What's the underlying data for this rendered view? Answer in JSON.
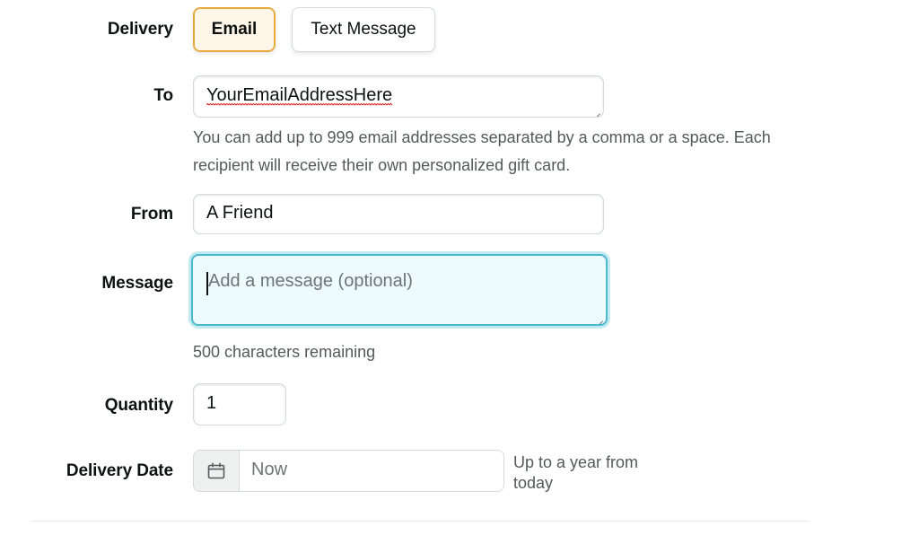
{
  "form": {
    "delivery": {
      "label": "Delivery",
      "options": [
        {
          "label": "Email",
          "selected": true
        },
        {
          "label": "Text Message",
          "selected": false
        }
      ]
    },
    "to": {
      "label": "To",
      "value": "YourEmailAddressHere",
      "helper": "You can add up to 999 email addresses separated by a comma or a space. Each recipient will receive their own personalized gift card."
    },
    "from": {
      "label": "From",
      "value": "A Friend"
    },
    "message": {
      "label": "Message",
      "value": "",
      "placeholder": "Add a message (optional)",
      "helper": "500 characters remaining",
      "focused": true
    },
    "quantity": {
      "label": "Quantity",
      "value": "1"
    },
    "delivery_date": {
      "label": "Delivery Date",
      "placeholder": "Now",
      "icon": "calendar-icon",
      "note": "Up to a year from today"
    }
  },
  "colors": {
    "selected_border": "#e6a93b",
    "selected_background": "#fdf6e9",
    "focus_border": "#4db8cf",
    "focus_background": "#edfbfd",
    "field_border": "#d5d9d9",
    "helper_text": "#565959",
    "spellcheck_underline": "#e02020"
  }
}
